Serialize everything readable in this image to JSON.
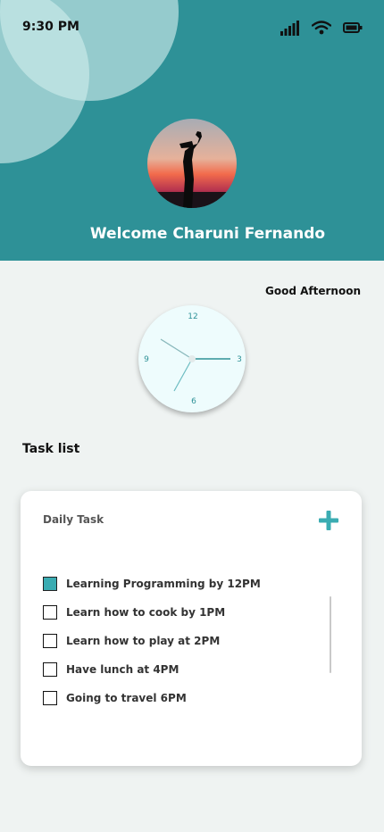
{
  "status_bar": {
    "time": "9:30 PM",
    "icons": [
      "cellular-signal-icon",
      "wifi-icon",
      "battery-icon"
    ]
  },
  "header": {
    "welcome_text": "Welcome Charuni Fernando",
    "background_color": "#2e9197"
  },
  "greeting": "Good Afternoon",
  "clock": {
    "numerals": [
      "12",
      "3",
      "6",
      "9"
    ],
    "accent_color": "#2e9197"
  },
  "tasks_section": {
    "heading": "Task list",
    "card_title": "Daily Task",
    "items": [
      {
        "label": "Learning Programming by 12PM",
        "checked": true
      },
      {
        "label": "Learn how to cook by 1PM",
        "checked": false
      },
      {
        "label": "Learn how to play at 2PM",
        "checked": false
      },
      {
        "label": "Have lunch at 4PM",
        "checked": false
      },
      {
        "label": "Going to travel 6PM",
        "checked": false
      }
    ],
    "accent_color": "#3aacb2"
  }
}
